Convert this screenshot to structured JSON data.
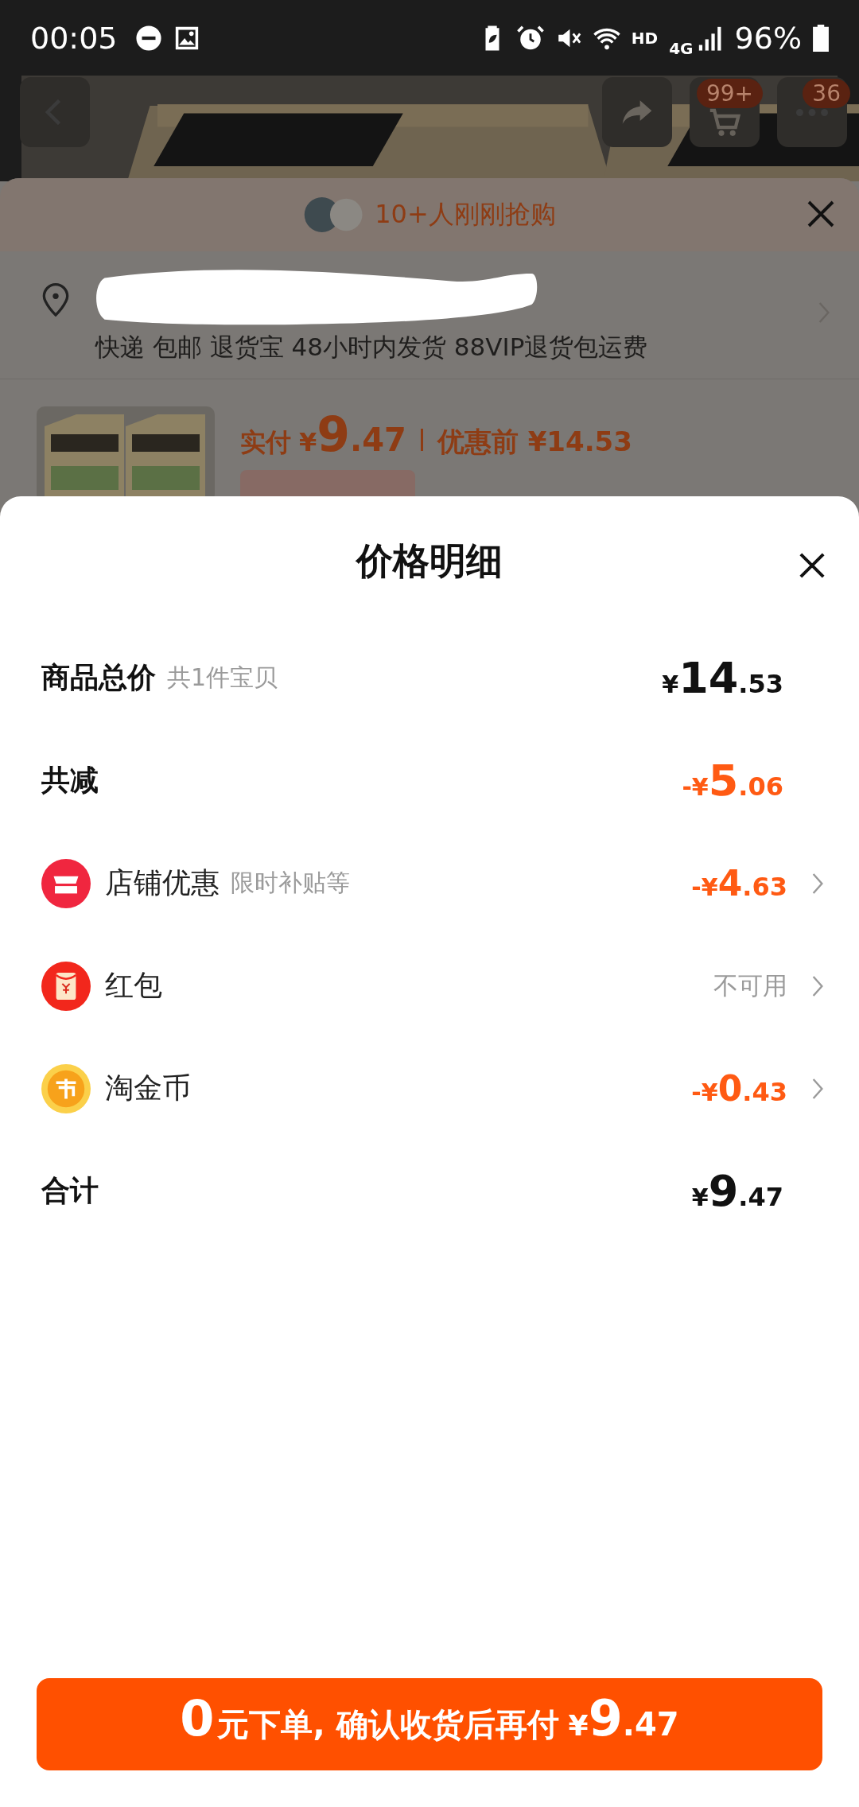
{
  "status_bar": {
    "time": "00:05",
    "network": "HD",
    "cellular": "4G",
    "battery": "96%"
  },
  "top_nav": {
    "buttons": [
      {
        "kind": "back"
      },
      {
        "kind": "share"
      },
      {
        "kind": "cart",
        "badge": "99+"
      },
      {
        "kind": "more",
        "badge": "36"
      }
    ]
  },
  "order_sheet": {
    "social_proof": "10+人刚刚抢购",
    "address": {
      "redacted": true,
      "services": "快递 包邮 退货宝 48小时内发货 88VIP退货包运费"
    },
    "product": {
      "paid_label": "实付",
      "paid": "¥9.47",
      "original_label": "优惠前",
      "original": "¥14.53"
    }
  },
  "price_detail": {
    "title": "价格明细",
    "rows": [
      {
        "kind": "heading",
        "label": "商品总价",
        "note": "共1件宝贝",
        "value": "¥14.53",
        "discount": false
      },
      {
        "kind": "heading",
        "label": "共减",
        "value": "-¥5.06",
        "discount": true
      },
      {
        "kind": "shop",
        "label": "店铺优惠",
        "note": "限时补贴等",
        "value": "-¥4.63",
        "discount": true,
        "chevron": true
      },
      {
        "kind": "envelope",
        "label": "红包",
        "value": "不可用",
        "discount": false,
        "chevron": true
      },
      {
        "kind": "coin",
        "label": "淘金币",
        "value": "-¥0.43",
        "discount": true,
        "chevron": true
      },
      {
        "kind": "heading",
        "label": "合计",
        "value": "¥9.47",
        "discount": false
      }
    ],
    "button": {
      "lead": "0",
      "text": "元下单, 确认收货后再付",
      "amount": "¥9.47"
    }
  }
}
